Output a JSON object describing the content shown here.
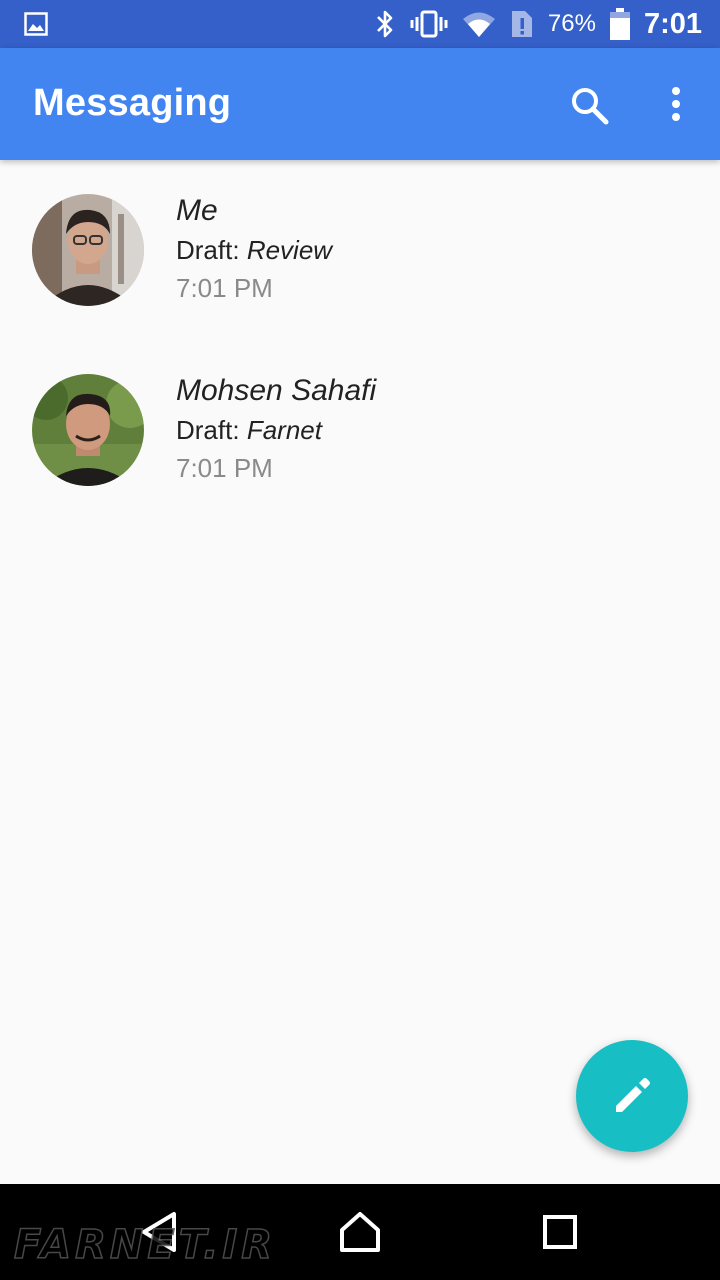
{
  "status_bar": {
    "battery_percent": "76%",
    "time": "7:01",
    "icons": [
      "image-icon",
      "bluetooth-icon",
      "vibrate-icon",
      "wifi-icon",
      "no-sim-icon",
      "battery-icon"
    ]
  },
  "app_bar": {
    "title": "Messaging",
    "actions": [
      "search-icon",
      "more-vert-icon"
    ],
    "color": "#4285f0"
  },
  "conversations": [
    {
      "name": "Me",
      "draft_prefix": "Draft:",
      "draft_text": "Review",
      "time": "7:01 PM"
    },
    {
      "name": "Mohsen Sahafi",
      "draft_prefix": "Draft:",
      "draft_text": "Farnet",
      "time": "7:01 PM"
    }
  ],
  "fab": {
    "icon": "pencil-icon",
    "color": "#17bfc4"
  },
  "nav_bar": {
    "buttons": [
      "back-icon",
      "home-icon",
      "recents-icon"
    ]
  },
  "watermark": "FARNET.IR"
}
